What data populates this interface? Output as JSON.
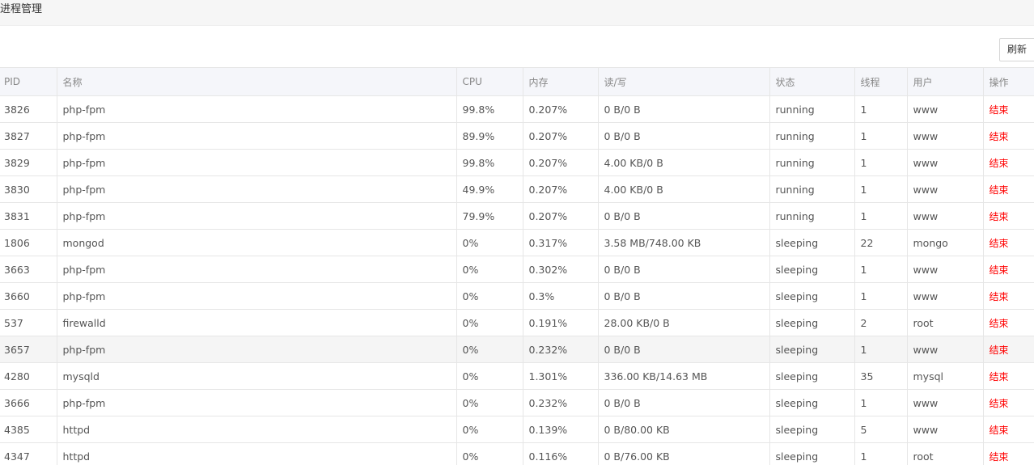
{
  "header": {
    "title": "进程管理"
  },
  "toolbar": {
    "refresh_label": "刷新"
  },
  "table": {
    "columns": [
      "PID",
      "名称",
      "CPU",
      "内存",
      "读/写",
      "状态",
      "线程",
      "用户",
      "操作"
    ],
    "action_label": "结束",
    "rows": [
      {
        "pid": "3826",
        "name": "php-fpm",
        "cpu": "99.8%",
        "mem": "0.207%",
        "io": "0 B/0 B",
        "status": "running",
        "threads": "1",
        "user": "www"
      },
      {
        "pid": "3827",
        "name": "php-fpm",
        "cpu": "89.9%",
        "mem": "0.207%",
        "io": "0 B/0 B",
        "status": "running",
        "threads": "1",
        "user": "www"
      },
      {
        "pid": "3829",
        "name": "php-fpm",
        "cpu": "99.8%",
        "mem": "0.207%",
        "io": "4.00 KB/0 B",
        "status": "running",
        "threads": "1",
        "user": "www"
      },
      {
        "pid": "3830",
        "name": "php-fpm",
        "cpu": "49.9%",
        "mem": "0.207%",
        "io": "4.00 KB/0 B",
        "status": "running",
        "threads": "1",
        "user": "www"
      },
      {
        "pid": "3831",
        "name": "php-fpm",
        "cpu": "79.9%",
        "mem": "0.207%",
        "io": "0 B/0 B",
        "status": "running",
        "threads": "1",
        "user": "www"
      },
      {
        "pid": "1806",
        "name": "mongod",
        "cpu": "0%",
        "mem": "0.317%",
        "io": "3.58 MB/748.00 KB",
        "status": "sleeping",
        "threads": "22",
        "user": "mongo"
      },
      {
        "pid": "3663",
        "name": "php-fpm",
        "cpu": "0%",
        "mem": "0.302%",
        "io": "0 B/0 B",
        "status": "sleeping",
        "threads": "1",
        "user": "www"
      },
      {
        "pid": "3660",
        "name": "php-fpm",
        "cpu": "0%",
        "mem": "0.3%",
        "io": "0 B/0 B",
        "status": "sleeping",
        "threads": "1",
        "user": "www"
      },
      {
        "pid": "537",
        "name": "firewalld",
        "cpu": "0%",
        "mem": "0.191%",
        "io": "28.00 KB/0 B",
        "status": "sleeping",
        "threads": "2",
        "user": "root"
      },
      {
        "pid": "3657",
        "name": "php-fpm",
        "cpu": "0%",
        "mem": "0.232%",
        "io": "0 B/0 B",
        "status": "sleeping",
        "threads": "1",
        "user": "www",
        "highlight": true
      },
      {
        "pid": "4280",
        "name": "mysqld",
        "cpu": "0%",
        "mem": "1.301%",
        "io": "336.00 KB/14.63 MB",
        "status": "sleeping",
        "threads": "35",
        "user": "mysql"
      },
      {
        "pid": "3666",
        "name": "php-fpm",
        "cpu": "0%",
        "mem": "0.232%",
        "io": "0 B/0 B",
        "status": "sleeping",
        "threads": "1",
        "user": "www"
      },
      {
        "pid": "4385",
        "name": "httpd",
        "cpu": "0%",
        "mem": "0.139%",
        "io": "0 B/80.00 KB",
        "status": "sleeping",
        "threads": "5",
        "user": "www"
      },
      {
        "pid": "4347",
        "name": "httpd",
        "cpu": "0%",
        "mem": "0.116%",
        "io": "0 B/76.00 KB",
        "status": "sleeping",
        "threads": "1",
        "user": "root"
      }
    ]
  }
}
